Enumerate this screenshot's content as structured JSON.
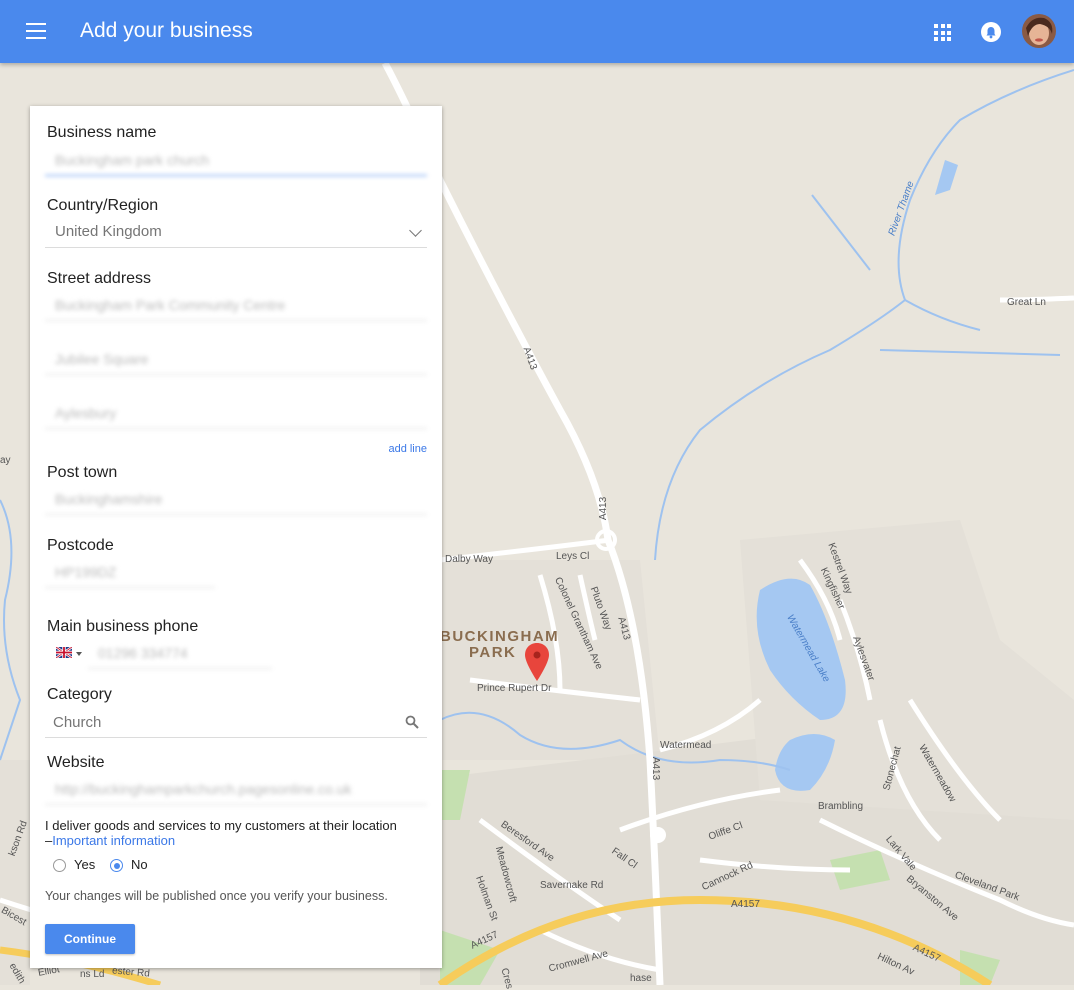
{
  "header": {
    "title": "Add your business",
    "icons": [
      "menu-icon",
      "apps-icon",
      "notifications-icon",
      "avatar"
    ],
    "bar_color": "#4a89ed"
  },
  "form": {
    "business_name": {
      "label": "Business name",
      "value": "Buckingham park church"
    },
    "country": {
      "label": "Country/Region",
      "value": "United Kingdom"
    },
    "street": {
      "label": "Street address",
      "lines": [
        "Buckingham Park Community Centre",
        "Jubilee Square",
        "Aylesbury"
      ],
      "add_line": "add line"
    },
    "post_town": {
      "label": "Post town",
      "value": "Buckinghamshire"
    },
    "postcode": {
      "label": "Postcode",
      "value": "HP199DZ"
    },
    "phone": {
      "label": "Main business phone",
      "value": "01296 334774",
      "flag": "uk-flag-icon"
    },
    "category": {
      "label": "Category",
      "value": "Church"
    },
    "website": {
      "label": "Website",
      "value": "http://buckinghamparkchurch.pagesonline.co.uk"
    },
    "deliver": {
      "text": "I deliver goods and services to my customers at their location",
      "dash": "–",
      "link": "Important information",
      "yes": "Yes",
      "no": "No",
      "selected": "No"
    },
    "publish_note": "Your changes will be published once you verify your business.",
    "continue": "Continue"
  },
  "map": {
    "area": [
      "BUCKINGHAM",
      "PARK"
    ],
    "roads": [
      "A413",
      "A413",
      "A413",
      "A413",
      "A4157",
      "A4157",
      "A4157",
      "Dalby Way",
      "Leys Cl",
      "Colonel Grantham Ave",
      "Pluto Way",
      "Prince Rupert Dr",
      "Watermead",
      "Brambling",
      "Stonechat",
      "Watermeadow",
      "Kestrel Way",
      "Kingfisher",
      "Aylesvater",
      "Lark Vale",
      "Cleveland Park",
      "Bryanston Ave",
      "Oliffe Cl",
      "Cannock Rd",
      "Beresford Ave",
      "Savernake Rd",
      "Meadowcroft",
      "Holman St",
      "Fall Cl",
      "Cromwell Ave",
      "Hilton Av",
      "Great Ln",
      "River Thame",
      "Watermead Lake",
      "Bicest",
      "ester Rd",
      "Elliot",
      "ns Ld",
      "kson Rd",
      "edith",
      "ay",
      "Cres",
      "hase"
    ]
  }
}
